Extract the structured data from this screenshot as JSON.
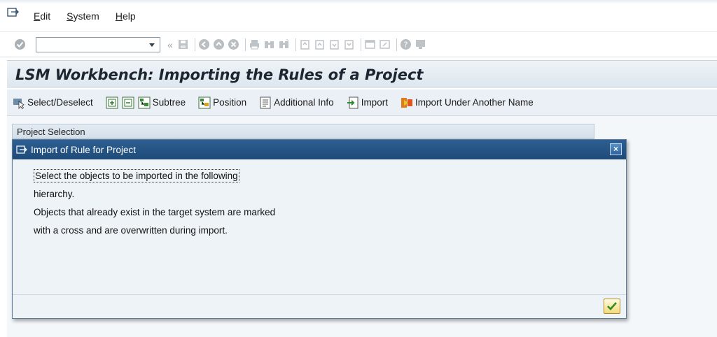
{
  "menu": {
    "items": [
      "Edit",
      "System",
      "Help"
    ]
  },
  "stdtoolbar": {
    "okcode_value": ""
  },
  "title": "LSM Workbench: Importing the Rules of a Project",
  "apptoolbar": {
    "select_deselect": "Select/Deselect",
    "subtree": "Subtree",
    "position": "Position",
    "additional_info": "Additional Info",
    "import": "Import",
    "import_another": "Import Under Another Name"
  },
  "project_selection": "Project Selection",
  "dialog": {
    "title": "Import of Rule for Project",
    "lines": [
      "Select the objects to be imported in the following",
      "hierarchy.",
      "Objects that already exist in the target system are marked",
      "with a cross and are overwritten during import."
    ]
  }
}
